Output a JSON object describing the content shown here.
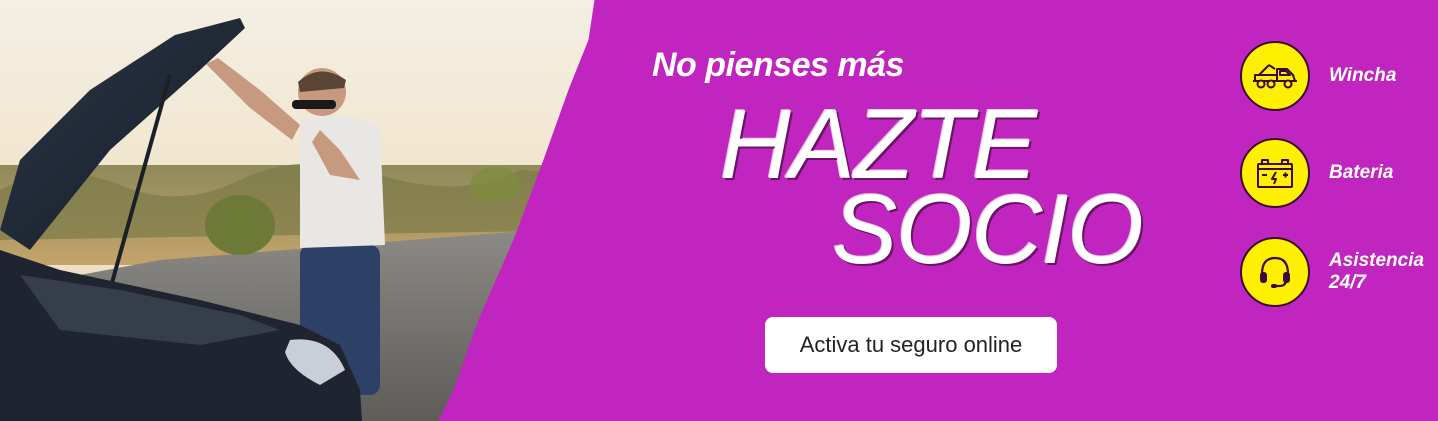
{
  "hero": {
    "tagline": "No pienses más",
    "headline_line1": "HAZTE",
    "headline_line2": "SOCIO"
  },
  "cta": {
    "label": "Activa tu seguro online"
  },
  "benefits": [
    {
      "label": "Wincha",
      "icon": "tow-truck-icon"
    },
    {
      "label": "Bateria",
      "icon": "car-battery-icon"
    },
    {
      "label": "Asistencia\n24/7",
      "icon": "headset-icon"
    }
  ],
  "colors": {
    "background": "#c026bf",
    "badge": "#ffef00",
    "text": "#ffffff",
    "cta_background": "#ffffff",
    "cta_text": "#222222"
  }
}
